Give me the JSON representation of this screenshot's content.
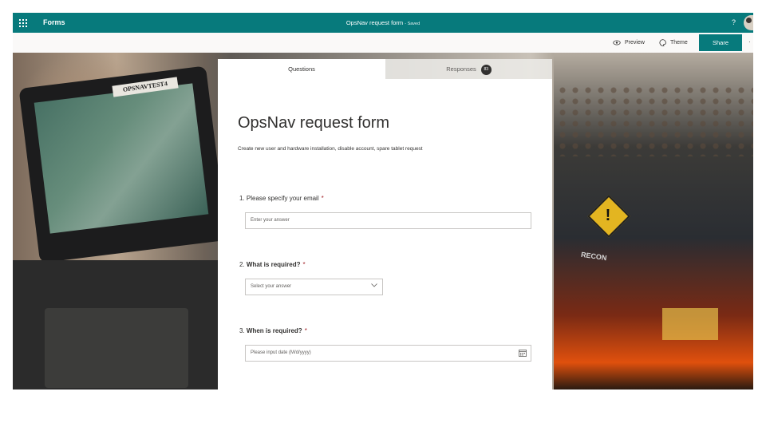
{
  "topbar": {
    "app_name": "Forms",
    "form_title": "OpsNav request form",
    "save_status": "- Saved",
    "help": "?"
  },
  "commandbar": {
    "preview_label": "Preview",
    "theme_label": "Theme",
    "share_label": "Share",
    "more": "·"
  },
  "background": {
    "tablet_label": "OPSNAVTEST4",
    "recon_label": "RECON"
  },
  "tabs": {
    "questions_label": "Questions",
    "responses_label": "Responses",
    "responses_count": "83"
  },
  "form": {
    "title": "OpsNav request form",
    "description": "Create new user and hardware installation, disable account, spare tablet request",
    "questions": [
      {
        "number": "1.",
        "label": "Please specify your email",
        "required_mark": "*",
        "placeholder": "Enter your answer"
      },
      {
        "number": "2.",
        "label": "What is required?",
        "required_mark": "*",
        "placeholder": "Select your answer"
      },
      {
        "number": "3.",
        "label": "When is required?",
        "required_mark": "*",
        "placeholder": "Please input date (M/d/yyyy)"
      }
    ]
  },
  "colors": {
    "brand_teal": "#077a7c",
    "required_red": "#a4262c"
  },
  "icons": [
    "waffle-icon",
    "eye-icon",
    "palette-icon",
    "chevron-down-icon",
    "calendar-icon"
  ]
}
